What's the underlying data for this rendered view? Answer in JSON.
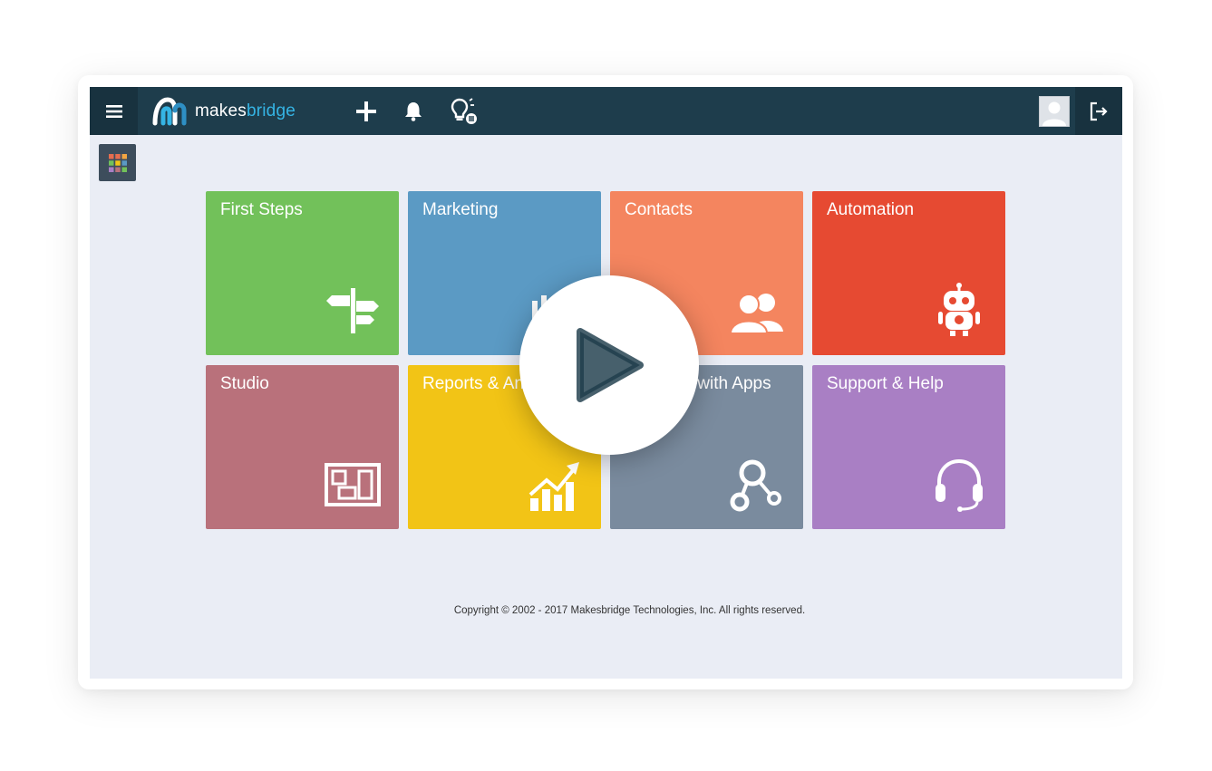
{
  "app": {
    "logo_prefix": "makes",
    "logo_accent": "bridge"
  },
  "topbar": {
    "menu_icon": "hamburger-icon",
    "add_icon": "plus-icon",
    "notifications_icon": "bell-icon",
    "ideas_icon": "lightbulb-icon",
    "avatar_icon": "user-avatar",
    "logout_icon": "logout-icon"
  },
  "apps_button": {
    "icon": "apps-grid-icon"
  },
  "tiles": [
    {
      "label": "First Steps",
      "color": "#72c15a",
      "icon": "signpost-icon"
    },
    {
      "label": "Marketing",
      "color": "#5b9ac4",
      "icon": "marketing-icon"
    },
    {
      "label": "Contacts",
      "color": "#f4855f",
      "icon": "users-icon"
    },
    {
      "label": "Automation",
      "color": "#e64a32",
      "icon": "robot-icon"
    },
    {
      "label": "Studio",
      "color": "#b9717b",
      "icon": "layout-icon"
    },
    {
      "label": "Reports & Analytics",
      "color": "#f2c416",
      "icon": "chart-growth-icon"
    },
    {
      "label": "Integrate with Apps",
      "color": "#7a8b9e",
      "icon": "integration-icon"
    },
    {
      "label": "Support & Help",
      "color": "#a97fc4",
      "icon": "headset-icon"
    }
  ],
  "footer": {
    "copyright": "Copyright © 2002 - 2017 Makesbridge Technologies, Inc. All rights reserved."
  },
  "video": {
    "play_icon": "play-icon"
  },
  "colors": {
    "topbar": "#1e3d4c",
    "background": "#eaedf5",
    "accent": "#35b4e4"
  }
}
